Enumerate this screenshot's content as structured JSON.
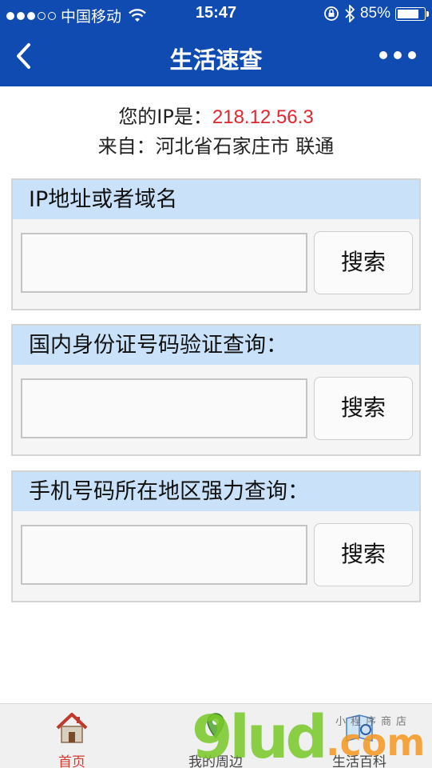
{
  "status_bar": {
    "carrier": "中国移动",
    "time": "15:47",
    "battery": "85%",
    "battery_level": 0.85
  },
  "nav": {
    "title": "生活速查",
    "back_icon": "chevron-left-icon",
    "more_icon": "more-dots-icon"
  },
  "ip_info": {
    "label": "您的IP是：",
    "ip": "218.12.56.3",
    "location": "来自：河北省石家庄市 联通"
  },
  "panels": [
    {
      "title": "IP地址或者域名",
      "input_value": "",
      "button_label": "搜索"
    },
    {
      "title": "国内身份证号码验证查询：",
      "input_value": "",
      "button_label": "搜索"
    },
    {
      "title": "手机号码所在地区强力查询：",
      "input_value": "",
      "button_label": "搜索"
    }
  ],
  "tabs": [
    {
      "label": "首页",
      "icon": "home-icon",
      "active": true
    },
    {
      "label": "我的周边",
      "icon": "location-icon",
      "active": false
    },
    {
      "label": "生活百科",
      "icon": "encyclopedia-icon",
      "active": false
    }
  ],
  "watermark": {
    "main": "9lud",
    "suffix": ".com",
    "small": "小程序商店"
  },
  "colors": {
    "brand_blue": "#0f4bb0",
    "ip_red": "#e3262d",
    "panel_header": "#c9e1f9",
    "active_tab": "#d43a2f"
  }
}
